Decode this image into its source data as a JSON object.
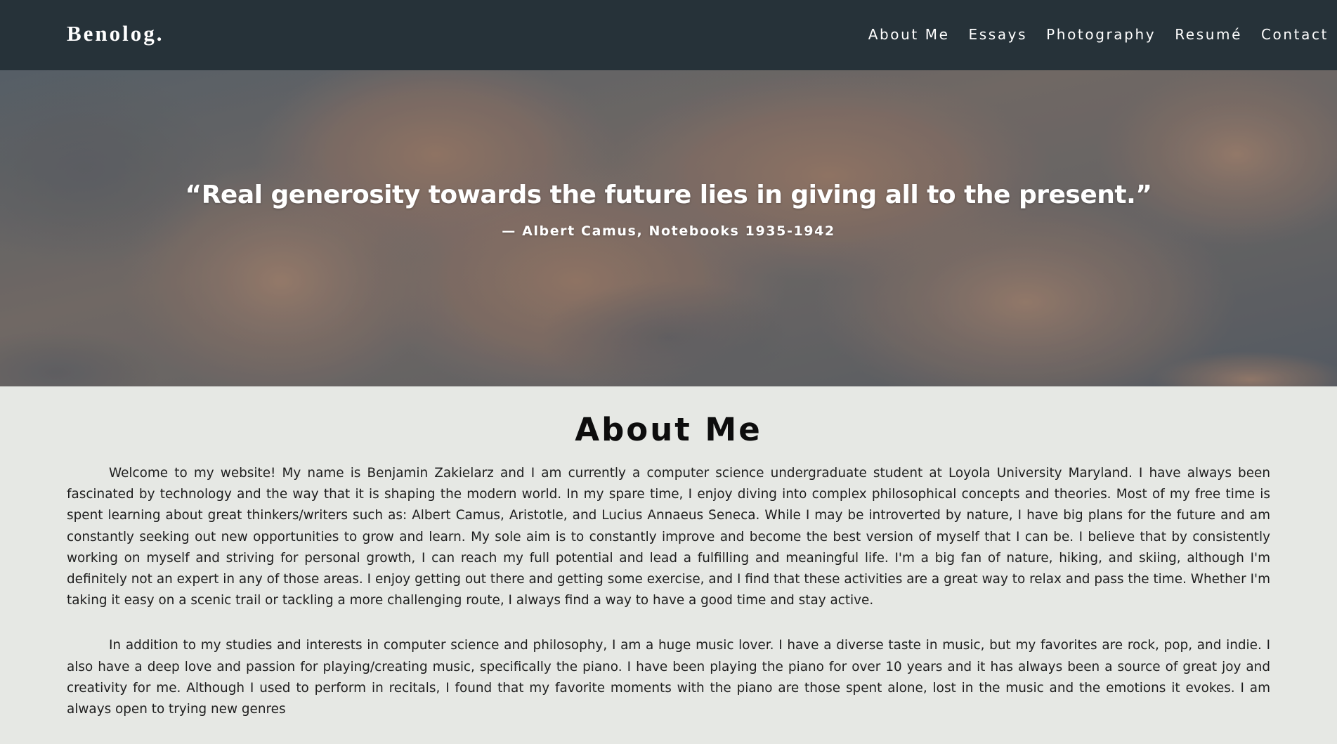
{
  "navbar": {
    "brand": "Benolog.",
    "links": [
      "About Me",
      "Essays",
      "Photography",
      "Resumé",
      "Contact"
    ]
  },
  "hero": {
    "quote": "“Real generosity towards the future lies in giving all to the present.”",
    "attribution": "— Albert Camus, Notebooks 1935-1942"
  },
  "about": {
    "title": "About Me",
    "paragraphs": [
      "Welcome to my website! My name is Benjamin Zakielarz and I am currently a computer science undergraduate student at Loyola University Maryland. I have always been fascinated by technology and the way that it is shaping the modern world. In my spare time, I enjoy diving into complex philosophical concepts and theories. Most of my free time is spent learning about great thinkers/writers such as: Albert Camus, Aristotle, and Lucius Annaeus Seneca. While I may be introverted by nature, I have big plans for the future and am constantly seeking out new opportunities to grow and learn. My sole aim is to constantly improve and become the best version of myself that I can be. I believe that by consistently working on myself and striving for personal growth, I can reach my full potential and lead a fulfilling and meaningful life. I'm a big fan of nature, hiking, and skiing, although I'm definitely not an expert in any of those areas. I enjoy getting out there and getting some exercise, and I find that these activities are a great way to relax and pass the time. Whether I'm taking it easy on a scenic trail or tackling a more challenging route, I always find a way to have a good time and stay active.",
      "In addition to my studies and interests in computer science and philosophy, I am a huge music lover. I have a diverse taste in music, but my favorites are rock, pop, and indie. I also have a deep love and passion for playing/creating music, specifically the piano. I have been playing the piano for over 10 years and it has always been a source of great joy and creativity for me. Although I used to perform in recitals, I found that my favorite moments with the piano are those spent alone, lost in the music and the emotions it evokes. I am always open to trying new genres"
    ]
  },
  "colors": {
    "navbar_bg": "#263239",
    "page_bg": "#e6e8e4",
    "text": "#1e1e1e",
    "hero_text": "#ffffff"
  }
}
